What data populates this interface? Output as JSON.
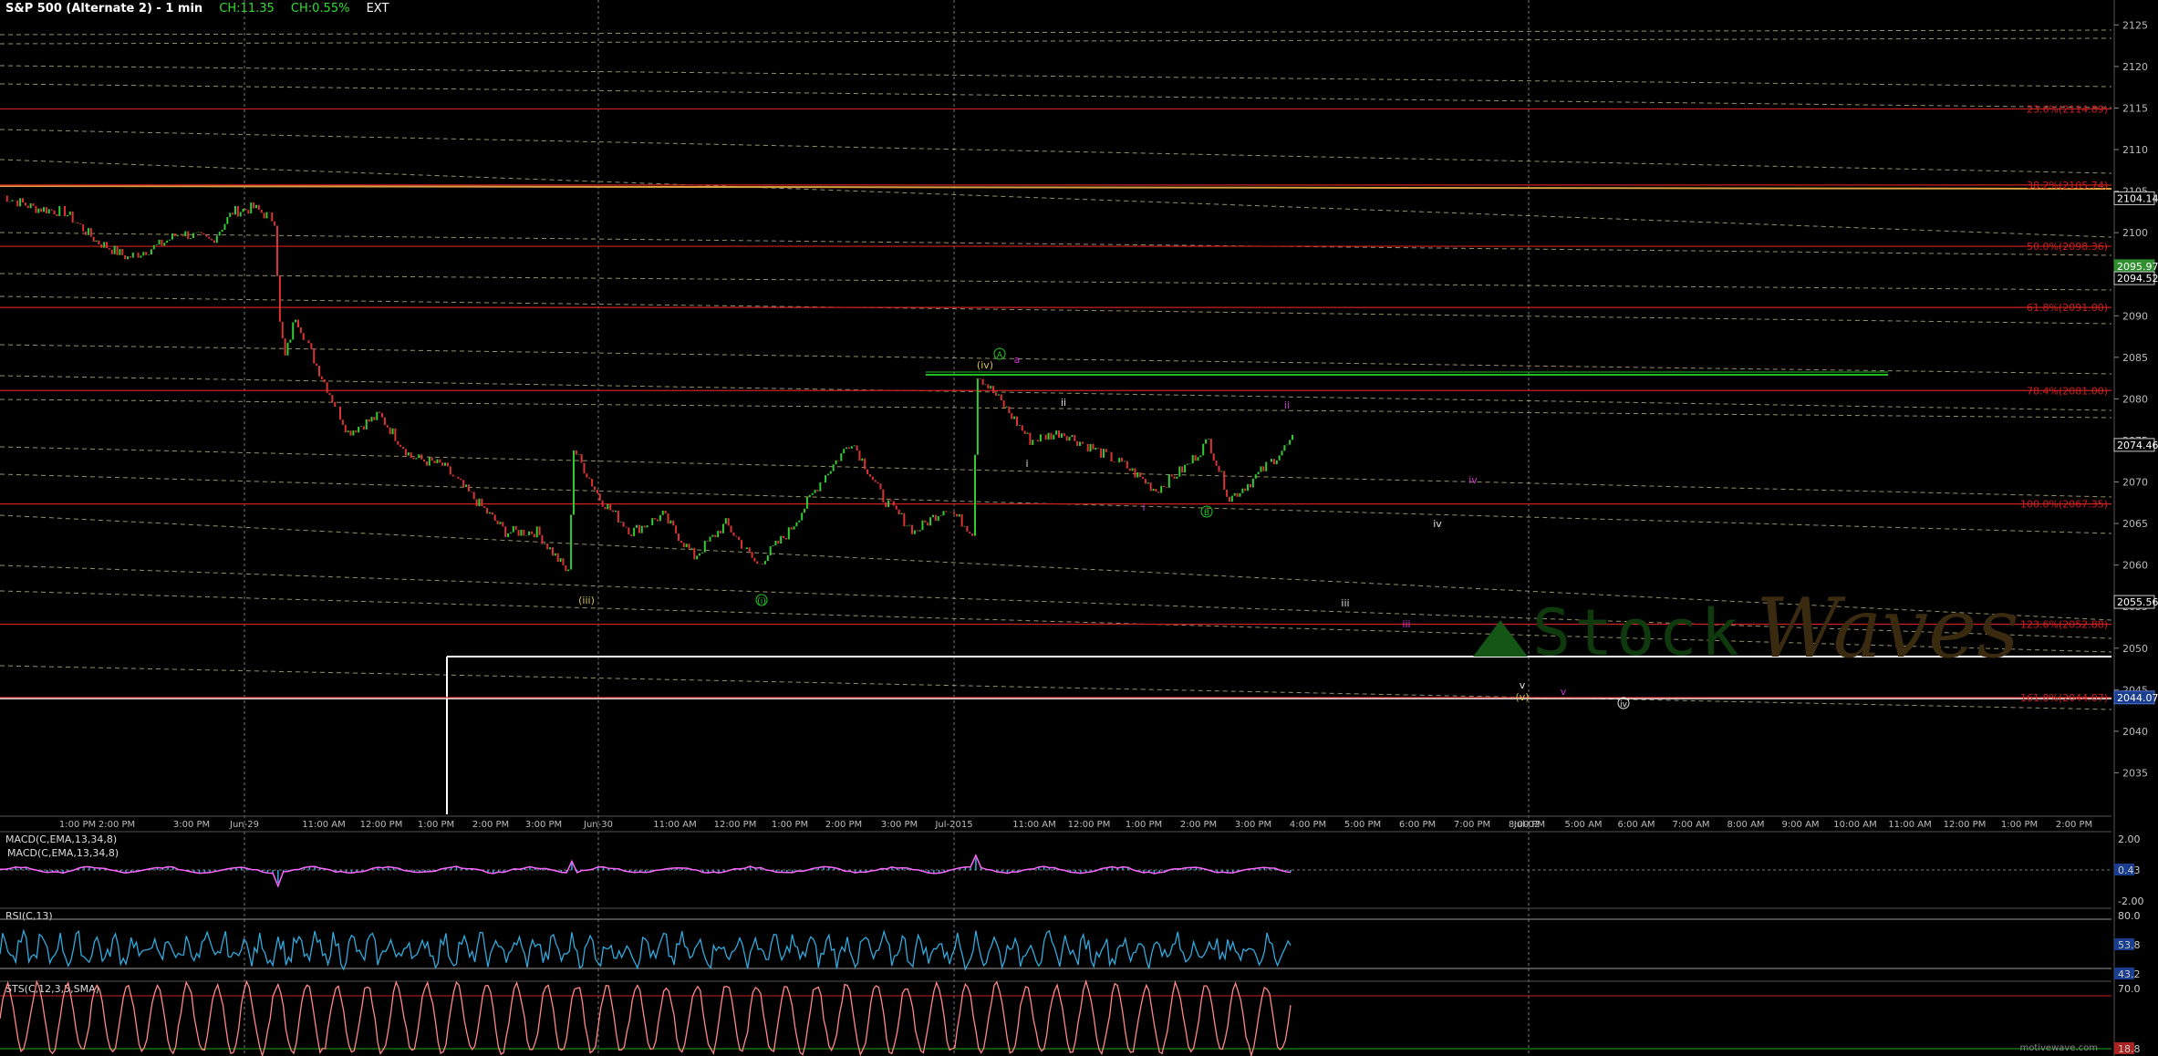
{
  "header": {
    "title": "S&P 500 (Alternate 2) - 1 min",
    "change": "CH:11.35",
    "change_pct": "CH:0.55%",
    "session": "EXT"
  },
  "footer": {
    "brand": "motivewave.com"
  },
  "watermark": {
    "text": "Waves",
    "faded_text": "Stock"
  },
  "colors": {
    "background": "#000000",
    "fib_line": "#cc1f1f",
    "channel_line": "#c8c28a",
    "up_bar": "#33cc33",
    "down_bar": "#dd3333",
    "macd_line": "#ff66ff",
    "macd_hist": "#33aadd",
    "rsi_line": "#33aadd",
    "stoch_line": "#ff8888",
    "wave_green": "#22cc22",
    "wave_magenta": "#cc33cc",
    "wave_yellow": "#d6c25a",
    "wave_white": "#e0e0e0",
    "price_tag_green": "#2f8f2f",
    "price_tag_blue": "#1b3d8f"
  },
  "chart_data": [
    {
      "type": "line",
      "pane": "price",
      "ylim": [
        2030,
        2128
      ],
      "yticks": [
        2035,
        2040,
        2045,
        2050,
        2055,
        2060,
        2065,
        2070,
        2075,
        2080,
        2085,
        2090,
        2095,
        2100,
        2105,
        2110,
        2115,
        2120,
        2125
      ],
      "x_tick_labels": [
        "1:00 PM",
        "2:00 PM",
        "3:00 PM",
        "Jun-29",
        "11:00 AM",
        "12:00 PM",
        "1:00 PM",
        "2:00 PM",
        "3:00 PM",
        "Jun-30",
        "11:00 AM",
        "12:00 PM",
        "1:00 PM",
        "2:00 PM",
        "3:00 PM",
        "Jul-2015",
        "11:00 AM",
        "12:00 PM",
        "1:00 PM",
        "2:00 PM",
        "3:00 PM",
        "4:00 PM",
        "5:00 PM",
        "6:00 PM",
        "7:00 PM",
        "8:00 PM",
        "Jul-02",
        "5:00 AM",
        "6:00 AM",
        "7:00 AM",
        "8:00 AM",
        "9:00 AM",
        "10:00 AM",
        "11:00 AM",
        "12:00 PM",
        "1:00 PM",
        "2:00 PM"
      ],
      "series": [
        {
          "points": [
            [
              0,
              2104.5
            ],
            [
              6,
              2103
            ],
            [
              12,
              2102.5
            ],
            [
              18,
              2099
            ],
            [
              24,
              2097
            ],
            [
              30,
              2098.5
            ],
            [
              34,
              2100
            ],
            [
              40,
              2099
            ],
            [
              44,
              2102.5
            ],
            [
              48,
              2103
            ],
            [
              52,
              2101.5
            ],
            [
              53,
              2089
            ],
            [
              54,
              2085
            ],
            [
              56,
              2090
            ],
            [
              60,
              2084
            ],
            [
              66,
              2076
            ],
            [
              72,
              2078
            ],
            [
              78,
              2073
            ],
            [
              84,
              2072
            ],
            [
              90,
              2068
            ],
            [
              96,
              2064
            ],
            [
              102,
              2064
            ],
            [
              108,
              2059
            ],
            [
              109,
              2074
            ],
            [
              114,
              2068
            ],
            [
              120,
              2064
            ],
            [
              126,
              2066
            ],
            [
              132,
              2061
            ],
            [
              138,
              2065
            ],
            [
              144,
              2060
            ],
            [
              150,
              2064
            ],
            [
              156,
              2070
            ],
            [
              162,
              2075
            ],
            [
              168,
              2068
            ],
            [
              174,
              2064
            ],
            [
              180,
              2067
            ],
            [
              185,
              2064
            ],
            [
              186,
              2083
            ],
            [
              190,
              2080
            ],
            [
              196,
              2075
            ],
            [
              202,
              2076
            ],
            [
              208,
              2074
            ],
            [
              214,
              2072
            ],
            [
              220,
              2069
            ],
            [
              226,
              2072
            ],
            [
              230,
              2075
            ],
            [
              234,
              2068
            ],
            [
              238,
              2070
            ],
            [
              242,
              2072.5
            ],
            [
              246,
              2075
            ]
          ],
          "last_price": "2074.46"
        }
      ],
      "fib_levels": [
        {
          "label": "23.6%(2114.89)",
          "value": 2114.89
        },
        {
          "label": "38.2%(2105.74)",
          "value": 2105.74
        },
        {
          "label": "50.0%(2098.36)",
          "value": 2098.36
        },
        {
          "label": "61.8%(2091.00)",
          "value": 2091.0
        },
        {
          "label": "78.4%(2081.00)",
          "value": 2081.0
        },
        {
          "label": "100.0%(2067.35)",
          "value": 2067.35
        },
        {
          "label": "123.6%(2052.88)",
          "value": 2052.88
        },
        {
          "label": "161.8%(2044.07)",
          "value": 2044.07
        }
      ],
      "price_tags": [
        {
          "text": "2104.14",
          "value": 2104.14,
          "style": "white"
        },
        {
          "text": "2095.97",
          "value": 2095.97,
          "style": "green"
        },
        {
          "text": "2094.52",
          "value": 2094.52,
          "style": "white"
        },
        {
          "text": "2074.46",
          "value": 2074.46,
          "style": "white"
        },
        {
          "text": "2055.56",
          "value": 2055.56,
          "style": "white"
        },
        {
          "text": "2044.07",
          "value": 2044.07,
          "style": "blue"
        }
      ],
      "wave_labels": [
        {
          "text": "(iii)",
          "value": 2057,
          "color": "yellow"
        },
        {
          "text": "(i)",
          "value": 2057,
          "color": "green"
        },
        {
          "text": "(iv)",
          "value": 2083,
          "color": "yellow"
        },
        {
          "text": "A",
          "value": 2084.5,
          "color": "green"
        },
        {
          "text": "a",
          "value": 2084,
          "color": "magenta"
        },
        {
          "text": "ii",
          "value": 2079,
          "color": "white"
        },
        {
          "text": "i",
          "value": 2072,
          "color": "white"
        },
        {
          "text": "i",
          "value": 2067,
          "color": "magenta"
        },
        {
          "text": "B",
          "value": 2066,
          "color": "green"
        },
        {
          "text": "ii",
          "value": 2079,
          "color": "magenta"
        },
        {
          "text": "iv",
          "value": 2070,
          "color": "magenta"
        },
        {
          "text": "iv",
          "value": 2065,
          "color": "white"
        },
        {
          "text": "iii",
          "value": 2055,
          "color": "white"
        },
        {
          "text": "iii",
          "value": 2052,
          "color": "magenta"
        },
        {
          "text": "v",
          "value": 2045.5,
          "color": "white"
        },
        {
          "text": "(v)",
          "value": 2044,
          "color": "yellow"
        },
        {
          "text": "v",
          "value": 2044.5,
          "color": "magenta"
        },
        {
          "text": "iv",
          "value": 2043,
          "color": "white"
        }
      ]
    },
    {
      "type": "line",
      "pane": "macd",
      "label_1": "MACD(C,EMA,13,34,8)",
      "label_2": "MACD(C,EMA,13,34,8)",
      "yticks": [
        "2.00",
        "0.43",
        "-2.00"
      ],
      "ylim": [
        -3,
        3
      ]
    },
    {
      "type": "line",
      "pane": "rsi",
      "label": "RSI(C,13)",
      "yticks": [
        "80.0",
        "53.8",
        "43.2"
      ],
      "ylim": [
        20,
        90
      ]
    },
    {
      "type": "line",
      "pane": "stoch",
      "label": "STS(C,12,3,5,SMA)",
      "yticks": [
        "70.0",
        "18.8"
      ],
      "ylim": [
        0,
        100
      ]
    }
  ]
}
